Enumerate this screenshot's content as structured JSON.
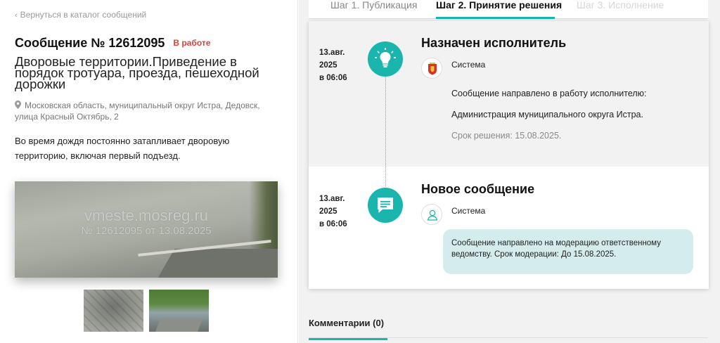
{
  "nav": {
    "back_label": "Вернуться в каталог сообщений"
  },
  "message": {
    "title": "Сообщение № 12612095",
    "status": "В работе",
    "status_color": "#e0403a",
    "subject": "Дворовые территории.Приведение в порядок тротуара, проезда, пешеходной дорожки",
    "address": "Московская область, муниципальный округ Истра, Дедовск, улица Красный Октябрь, 2",
    "description": "Во время дождя постоянно затапливает дворовую территорию, включая первый подъезд."
  },
  "photo": {
    "watermark_site": "vmeste.mosreg.ru",
    "watermark_caption": "№ 12612095 от 13.08.2025",
    "thumbnails": [
      "thumb-tiles",
      "thumb-yard"
    ]
  },
  "tabs": [
    {
      "label": "Шаг 1. Публикация",
      "state": "done"
    },
    {
      "label": "Шаг 2. Принятие решения",
      "state": "active"
    },
    {
      "label": "Шаг 3. Исполнение",
      "state": "disabled"
    }
  ],
  "accent_color": "#1ab5ac",
  "events": [
    {
      "date_line1": "13.авг.",
      "date_line2": "2025",
      "date_line3": "в 06:06",
      "icon": "lightbulb-icon",
      "title": "Назначен исполнитель",
      "author": "Система",
      "author_avatar": "moscow-region-emblem",
      "text1": "Сообщение направлено в работу исполнителю:",
      "text2": "Администрация муниципального округа Истра.",
      "deadline": "Срок решения: 15.08.2025."
    },
    {
      "date_line1": "13.авг.",
      "date_line2": "2025",
      "date_line3": "в 06:06",
      "icon": "chat-icon",
      "title": "Новое сообщение",
      "author": "Система",
      "author_avatar": "user-icon",
      "bubble": "Сообщение направлено на модерацию ответственному ведомству. Срок модерации: До 15.08.2025."
    }
  ],
  "comments": {
    "label": "Комментарии (0)"
  }
}
